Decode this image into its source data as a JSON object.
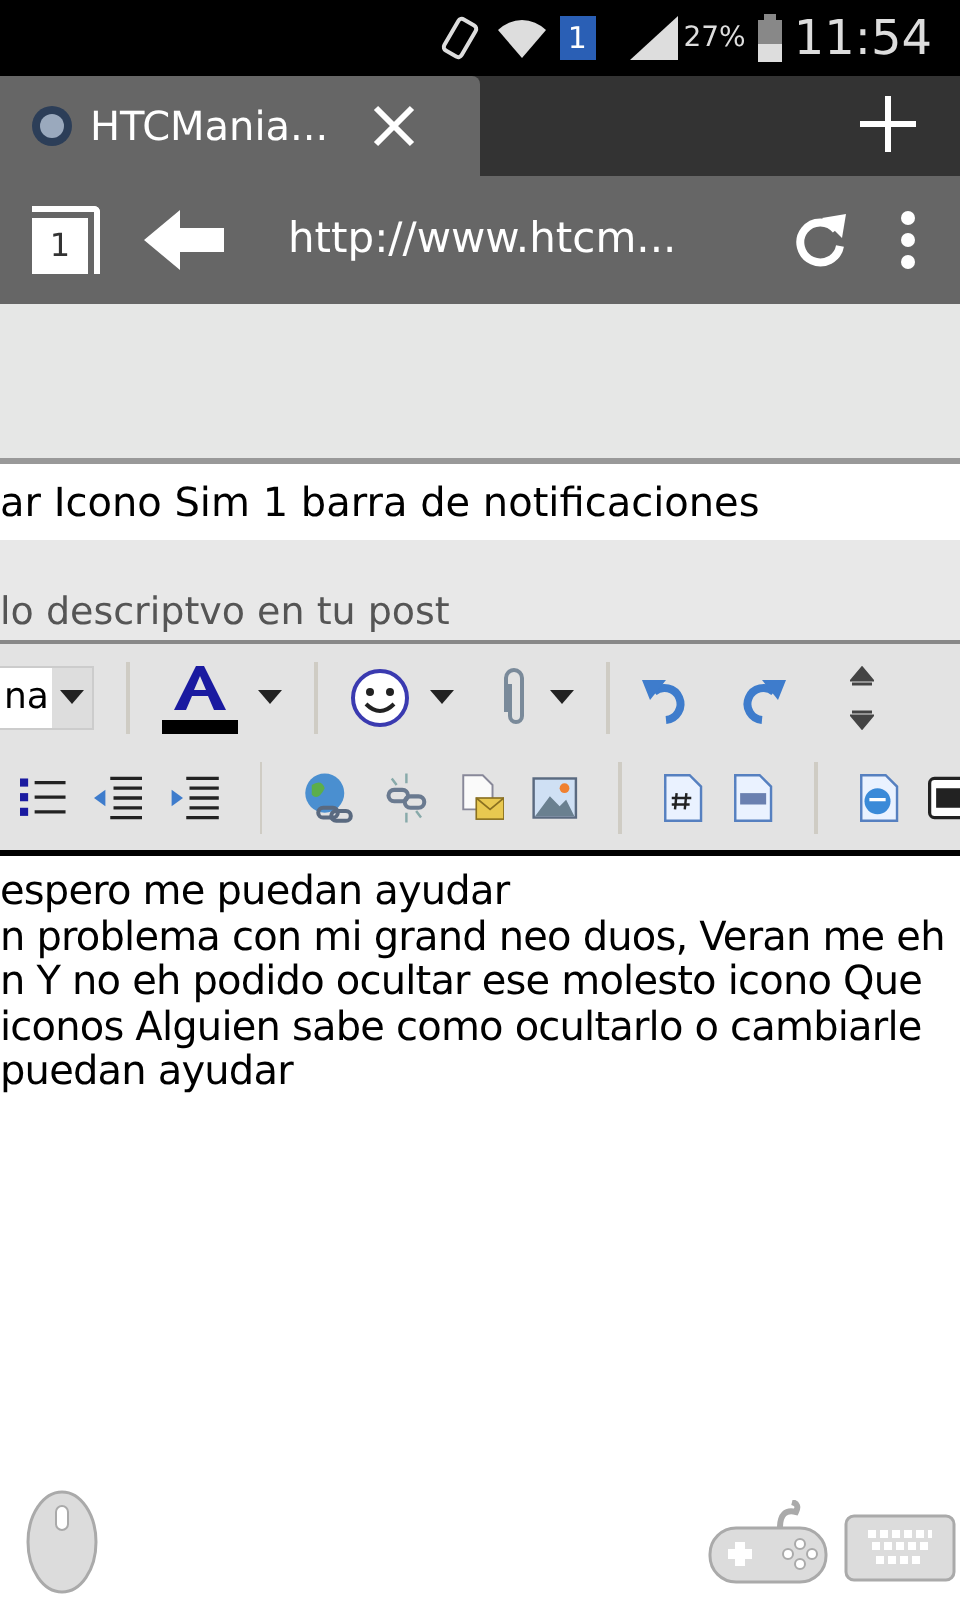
{
  "status_bar": {
    "sim": "1",
    "battery": "27%",
    "time": "11:54"
  },
  "browser": {
    "tab": {
      "title": "HTCMania...",
      "selected": true
    },
    "tab_count": "1",
    "url": "http://www.htcm..."
  },
  "post_form": {
    "title_value": "ar Icono Sim 1 barra de notificaciones",
    "hint": "lo descriptvo en tu post",
    "font_select": "na",
    "editor_lines": [
      "espero me puedan ayudar",
      "n problema con mi grand neo duos, Veran me eh",
      "n Y no eh podido ocultar ese molesto icono Que",
      "iconos Alguien sabe como ocultarlo o cambiarle",
      "puedan ayudar"
    ]
  }
}
